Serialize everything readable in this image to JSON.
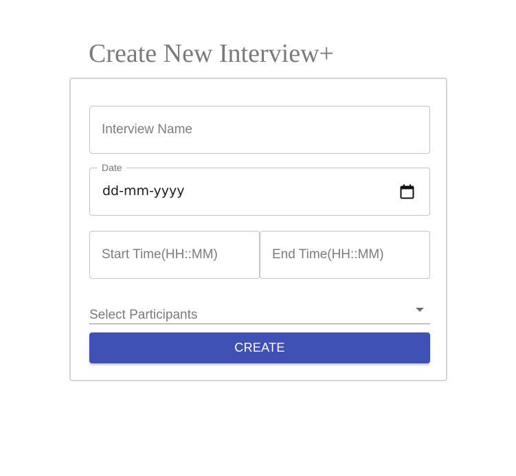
{
  "header": {
    "title": "Create New Interview+"
  },
  "form": {
    "interview_name": {
      "placeholder": "Interview Name",
      "value": ""
    },
    "date": {
      "label": "Date",
      "display_value": "dd-mm-yyyy",
      "icon": "calendar-icon"
    },
    "start_time": {
      "placeholder": "Start Time(HH::MM)",
      "value": ""
    },
    "end_time": {
      "placeholder": "End Time(HH::MM)",
      "value": ""
    },
    "participants": {
      "label": "Select Participants",
      "icon": "dropdown-arrow-icon"
    },
    "submit_label": "CREATE"
  },
  "colors": {
    "primary_button": "#3f51b5",
    "title_text": "#7a7a7a",
    "border": "#c4c4c4"
  }
}
